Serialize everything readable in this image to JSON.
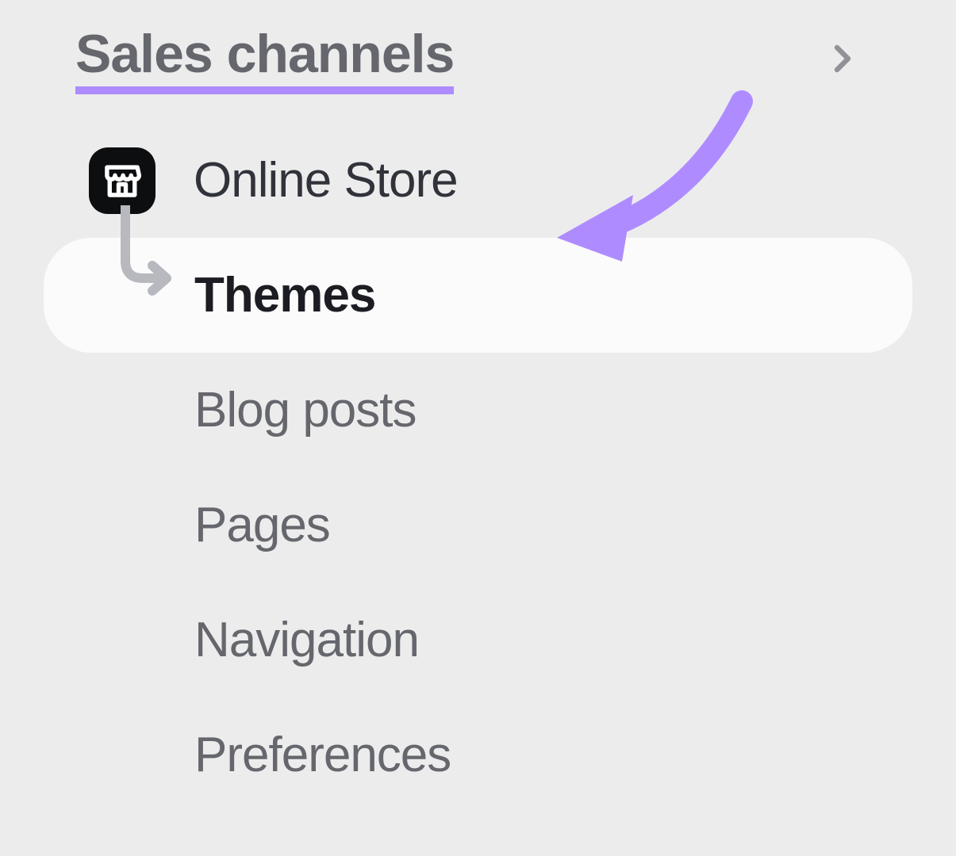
{
  "section": {
    "title": "Sales channels"
  },
  "sidebar": {
    "parent_label": "Online Store",
    "items": [
      {
        "label": "Themes"
      },
      {
        "label": "Blog posts"
      },
      {
        "label": "Pages"
      },
      {
        "label": "Navigation"
      },
      {
        "label": "Preferences"
      }
    ]
  },
  "colors": {
    "accent": "#ae8cff",
    "text_muted": "#65676d",
    "text_strong": "#1c1d22",
    "bg": "#ececed",
    "row_active_bg": "#fbfbfb"
  }
}
